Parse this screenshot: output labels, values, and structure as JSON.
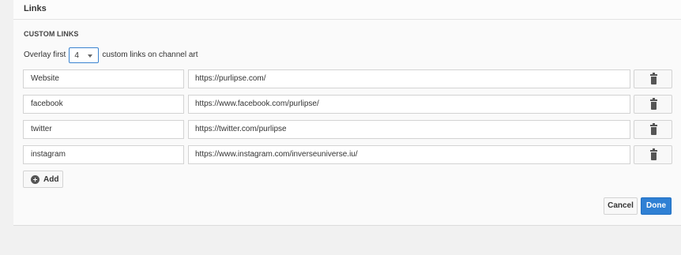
{
  "panel": {
    "title": "Links"
  },
  "custom_links": {
    "section_title": "CUSTOM LINKS",
    "overlay_prefix": "Overlay first",
    "overlay_value": "4",
    "overlay_suffix": "custom links on channel art",
    "links": [
      {
        "name": "Website",
        "url": "https://purlipse.com/"
      },
      {
        "name": "facebook",
        "url": "https://www.facebook.com/purlipse/"
      },
      {
        "name": "twitter",
        "url": "https://twitter.com/purlipse"
      },
      {
        "name": "instagram",
        "url": "https://www.instagram.com/inverseuniverse.iu/"
      }
    ],
    "add_label": "Add"
  },
  "actions": {
    "cancel_label": "Cancel",
    "done_label": "Done"
  },
  "icons": {
    "delete": "trash-icon",
    "add": "plus-circle-icon",
    "dropdown": "caret-down-icon"
  },
  "colors": {
    "primary": "#2f80d4",
    "focus_border": "#3a83d0"
  }
}
